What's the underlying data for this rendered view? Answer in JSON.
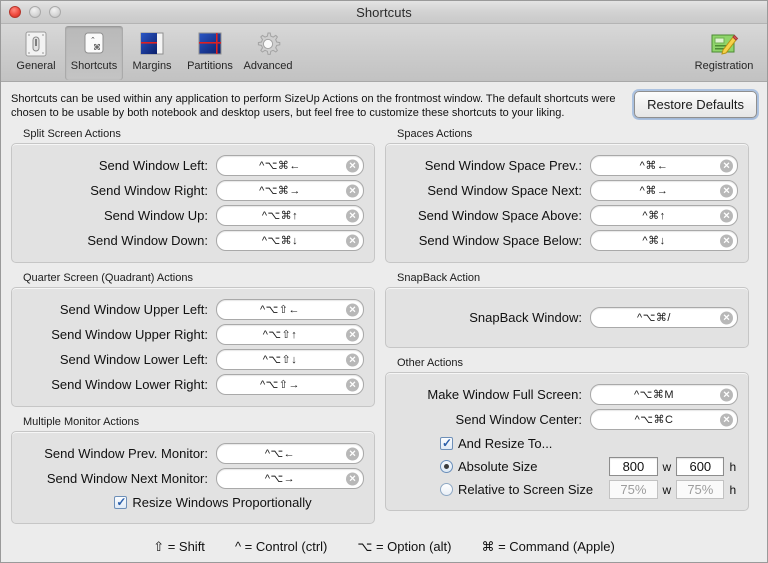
{
  "window": {
    "title": "Shortcuts",
    "controls": [
      "close",
      "minimize",
      "zoom"
    ]
  },
  "toolbar": {
    "items": [
      {
        "label": "General",
        "icon": "general-icon",
        "selected": false
      },
      {
        "label": "Shortcuts",
        "icon": "shortcuts-icon",
        "selected": true
      },
      {
        "label": "Margins",
        "icon": "margins-icon",
        "selected": false
      },
      {
        "label": "Partitions",
        "icon": "partitions-icon",
        "selected": false
      },
      {
        "label": "Advanced",
        "icon": "gear-icon",
        "selected": false
      }
    ],
    "registration": {
      "label": "Registration",
      "icon": "registration-icon"
    }
  },
  "intro": {
    "text": "Shortcuts can be used within any application to perform SizeUp Actions on the frontmost window. The default shortcuts were chosen to be usable by both notebook and desktop users, but feel free to customize these shortcuts to your liking.",
    "restore_label": "Restore Defaults"
  },
  "groups": {
    "split_screen": {
      "title": "Split Screen Actions",
      "rows": [
        {
          "label": "Send Window Left:",
          "shortcut": "^⌥⌘←"
        },
        {
          "label": "Send Window Right:",
          "shortcut": "^⌥⌘→"
        },
        {
          "label": "Send Window Up:",
          "shortcut": "^⌥⌘↑"
        },
        {
          "label": "Send Window Down:",
          "shortcut": "^⌥⌘↓"
        }
      ]
    },
    "quadrant": {
      "title": "Quarter Screen (Quadrant) Actions",
      "rows": [
        {
          "label": "Send Window Upper Left:",
          "shortcut": "^⌥⇧←"
        },
        {
          "label": "Send Window Upper Right:",
          "shortcut": "^⌥⇧↑"
        },
        {
          "label": "Send Window Lower Left:",
          "shortcut": "^⌥⇧↓"
        },
        {
          "label": "Send Window Lower Right:",
          "shortcut": "^⌥⇧→"
        }
      ]
    },
    "multi_monitor": {
      "title": "Multiple Monitor Actions",
      "rows": [
        {
          "label": "Send Window Prev. Monitor:",
          "shortcut": "^⌥←"
        },
        {
          "label": "Send Window Next Monitor:",
          "shortcut": "^⌥→"
        }
      ],
      "checkbox": {
        "label": "Resize Windows Proportionally",
        "checked": true
      }
    },
    "spaces": {
      "title": "Spaces Actions",
      "rows": [
        {
          "label": "Send Window Space Prev.:",
          "shortcut": "^⌘←"
        },
        {
          "label": "Send Window Space Next:",
          "shortcut": "^⌘→"
        },
        {
          "label": "Send Window Space Above:",
          "shortcut": "^⌘↑"
        },
        {
          "label": "Send Window Space Below:",
          "shortcut": "^⌘↓"
        }
      ]
    },
    "snapback": {
      "title": "SnapBack Action",
      "rows": [
        {
          "label": "SnapBack Window:",
          "shortcut": "^⌥⌘/"
        }
      ]
    },
    "other": {
      "title": "Other Actions",
      "rows": [
        {
          "label": "Make Window Full Screen:",
          "shortcut": "^⌥⌘M"
        },
        {
          "label": "Send Window Center:",
          "shortcut": "^⌥⌘C"
        }
      ],
      "resize_checkbox": {
        "label": "And Resize To...",
        "checked": true
      },
      "absolute": {
        "label": "Absolute Size",
        "selected": true,
        "width": "800",
        "height": "600",
        "unit_w": "w",
        "unit_h": "h"
      },
      "relative": {
        "label": "Relative to Screen Size",
        "selected": false,
        "width": "75%",
        "height": "75%",
        "unit_w": "w",
        "unit_h": "h"
      }
    }
  },
  "legend": [
    {
      "symbol": "⇧ = Shift"
    },
    {
      "symbol": "^ = Control (ctrl)"
    },
    {
      "symbol": "⌥ = Option (alt)"
    },
    {
      "symbol": "⌘ = Command (Apple)"
    }
  ],
  "clear_glyph": "✕"
}
